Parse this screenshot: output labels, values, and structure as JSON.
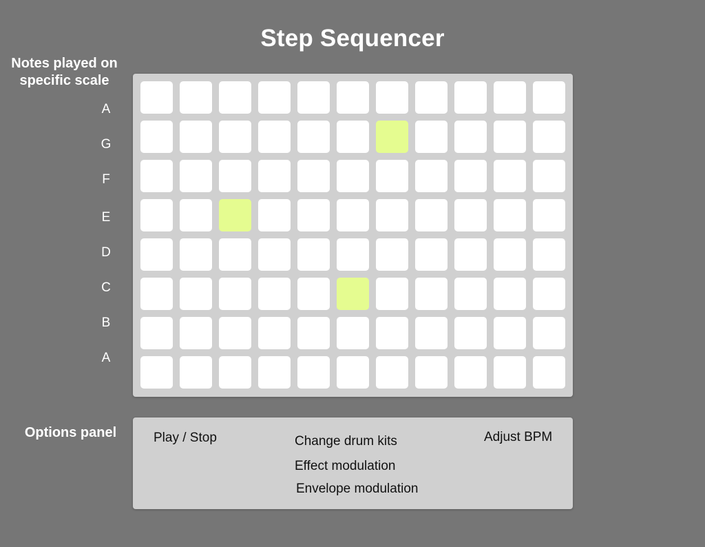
{
  "title": "Step Sequencer",
  "scale_heading_line1": "Notes played on",
  "scale_heading_line2": "specific scale",
  "notes": [
    "A",
    "G",
    "F",
    "E",
    "D",
    "C",
    "B",
    "A"
  ],
  "grid": {
    "rows": 8,
    "columns": 11,
    "active_cells": [
      {
        "row": 1,
        "col": 6
      },
      {
        "row": 3,
        "col": 2
      },
      {
        "row": 5,
        "col": 5
      }
    ],
    "active_color": "#e5fc90",
    "inactive_color": "#ffffff",
    "panel_color": "#d0d0d0"
  },
  "options_heading": "Options panel",
  "options": {
    "play_stop": "Play / Stop",
    "change_drum_kits": "Change drum kits",
    "effect_modulation": "Effect modulation",
    "envelope_modulation": "Envelope modulation",
    "adjust_bpm": "Adjust BPM"
  },
  "background_color": "#767676"
}
